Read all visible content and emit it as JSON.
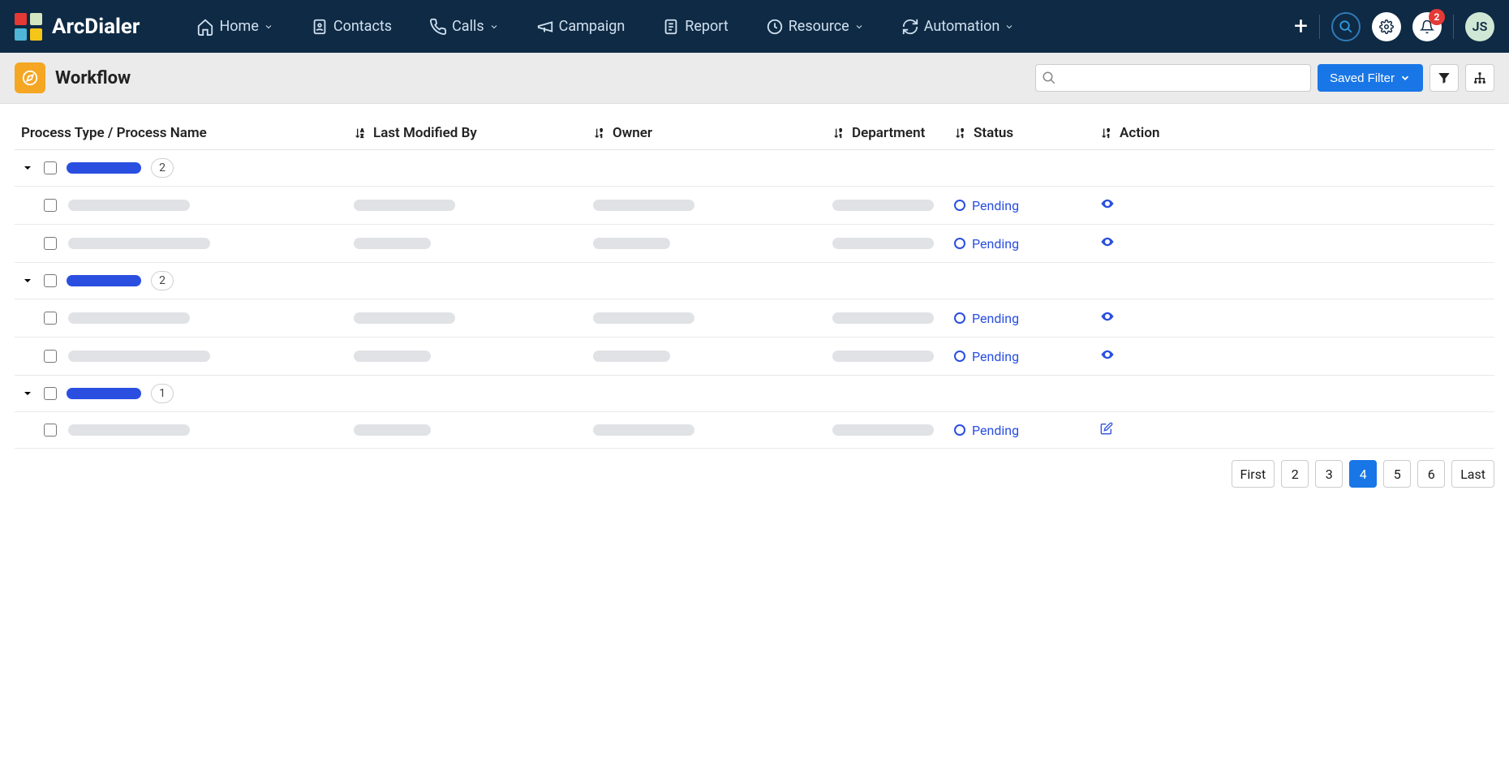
{
  "brand": "ArcDialer",
  "nav": [
    {
      "label": "Home",
      "icon": "home",
      "dropdown": true
    },
    {
      "label": "Contacts",
      "icon": "contacts",
      "dropdown": false
    },
    {
      "label": "Calls",
      "icon": "calls",
      "dropdown": true
    },
    {
      "label": "Campaign",
      "icon": "campaign",
      "dropdown": false
    },
    {
      "label": "Report",
      "icon": "report",
      "dropdown": false
    },
    {
      "label": "Resource",
      "icon": "resource",
      "dropdown": true
    },
    {
      "label": "Automation",
      "icon": "automation",
      "dropdown": true
    }
  ],
  "notification_count": "2",
  "avatar_initials": "JS",
  "page_title": "Workflow",
  "search_placeholder": "",
  "saved_filter_label": "Saved Filter",
  "columns": {
    "name": "Process Type / Process Name",
    "modified": "Last Modified By",
    "owner": "Owner",
    "department": "Department",
    "status": "Status",
    "action": "Action"
  },
  "groups": [
    {
      "count": "2",
      "rows": [
        {
          "name_w": 150,
          "mod_w": 125,
          "own_w": 125,
          "dep_w": 125,
          "status": "Pending",
          "action_icon": "eye"
        },
        {
          "name_w": 175,
          "mod_w": 95,
          "own_w": 95,
          "dep_w": 125,
          "status": "Pending",
          "action_icon": "eye"
        }
      ]
    },
    {
      "count": "2",
      "rows": [
        {
          "name_w": 150,
          "mod_w": 125,
          "own_w": 125,
          "dep_w": 125,
          "status": "Pending",
          "action_icon": "eye"
        },
        {
          "name_w": 175,
          "mod_w": 95,
          "own_w": 95,
          "dep_w": 125,
          "status": "Pending",
          "action_icon": "eye"
        }
      ]
    },
    {
      "count": "1",
      "rows": [
        {
          "name_w": 150,
          "mod_w": 95,
          "own_w": 125,
          "dep_w": 125,
          "status": "Pending",
          "action_icon": "edit"
        }
      ]
    }
  ],
  "pagination": {
    "first": "First",
    "pages": [
      "2",
      "3",
      "4",
      "5",
      "6"
    ],
    "current": "4",
    "last": "Last"
  }
}
